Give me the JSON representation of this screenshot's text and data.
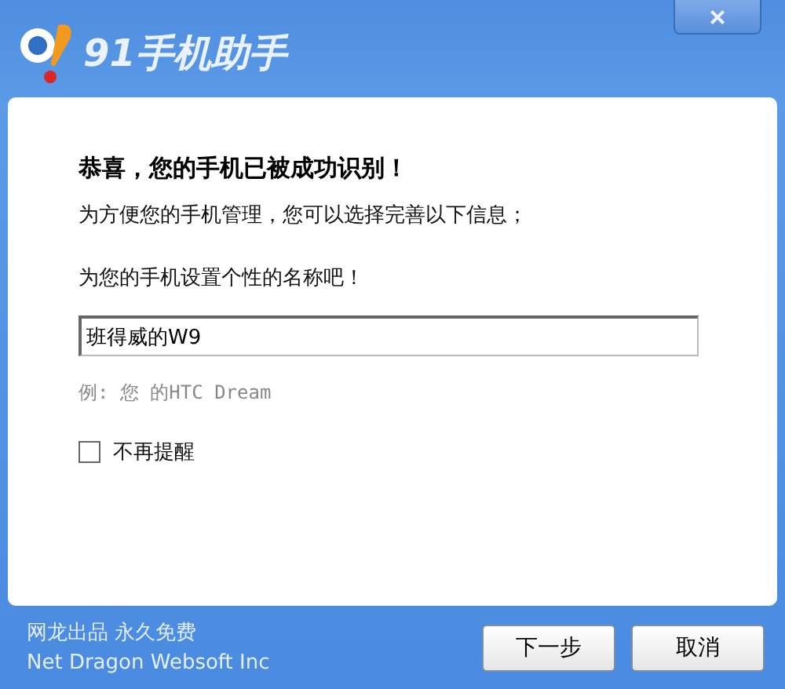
{
  "window": {
    "title": "91手机助手",
    "close": "×"
  },
  "content": {
    "heading": "恭喜，您的手机已被成功识别！",
    "intro": "为方便您的手机管理，您可以选择完善以下信息；",
    "prompt": "为您的手机设置个性的名称吧！",
    "name_field": {
      "value": "班得威的W9"
    },
    "example": "例: 您 的HTC Dream",
    "dont_remind": {
      "label": "不再提醒",
      "checked": false
    }
  },
  "footer": {
    "slogan": "网龙出品 永久免费",
    "company": "Net Dragon Websoft Inc",
    "buttons": [
      "下一步",
      "取消"
    ]
  }
}
